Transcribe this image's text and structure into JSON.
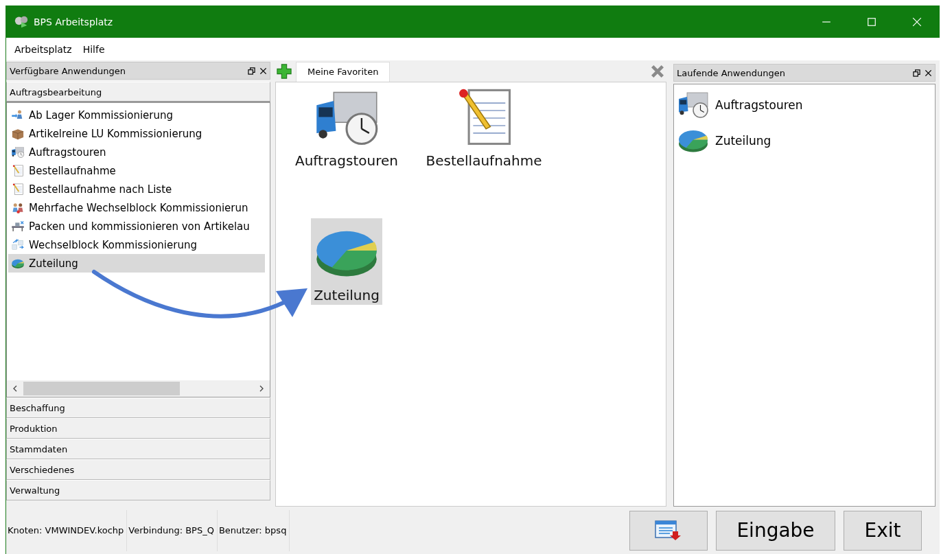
{
  "window": {
    "title": "BPS Arbeitsplatz"
  },
  "menu": [
    "Arbeitsplatz",
    "Hilfe"
  ],
  "left_panel": {
    "title": "Verfügbare Anwendungen",
    "sections_top": [
      {
        "label": "Auftragsbearbeitung",
        "expanded": true
      }
    ],
    "items": [
      {
        "label": "Ab Lager Kommissionierung",
        "kind": "picker",
        "selected": false
      },
      {
        "label": "Artikelreine LU Kommissionierung",
        "kind": "box",
        "selected": false
      },
      {
        "label": "Auftragstouren",
        "kind": "truck",
        "selected": false
      },
      {
        "label": "Bestellaufnahme",
        "kind": "notepad",
        "selected": false
      },
      {
        "label": "Bestellaufnahme nach Liste",
        "kind": "notepad",
        "selected": false
      },
      {
        "label": "Mehrfache Wechselblock Kommissionierun",
        "kind": "people",
        "selected": false
      },
      {
        "label": "Packen und kommissionieren von Artikelau",
        "kind": "machine",
        "selected": false
      },
      {
        "label": "Wechselblock Kommissionierung",
        "kind": "arrows",
        "selected": false
      },
      {
        "label": "Zuteilung",
        "kind": "pie",
        "selected": true
      }
    ],
    "sections_bottom": [
      "Beschaffung",
      "Produktion",
      "Stammdaten",
      "Verschiedenes",
      "Verwaltung"
    ]
  },
  "center": {
    "tabs": [
      {
        "label": "Meine Favoriten",
        "selected": true
      }
    ],
    "favorites": [
      {
        "label": "Auftragstouren",
        "kind": "truck",
        "selected": false
      },
      {
        "label": "Bestellaufnahme",
        "kind": "notepad",
        "selected": false
      },
      {
        "label": "Zuteilung",
        "kind": "pie",
        "selected": true
      }
    ]
  },
  "right_panel": {
    "title": "Laufende Anwendungen",
    "items": [
      {
        "label": "Auftragstouren",
        "kind": "truck"
      },
      {
        "label": "Zuteilung",
        "kind": "pie"
      }
    ]
  },
  "status_bar": [
    "Knoten: VMWINDEV.kochp",
    "Verbindung: BPS_Q",
    "Benutzer: bpsq"
  ],
  "buttons": [
    {
      "kind": "icon"
    },
    {
      "kind": "text",
      "label": "Eingabe"
    },
    {
      "kind": "text",
      "label": "Exit"
    }
  ]
}
